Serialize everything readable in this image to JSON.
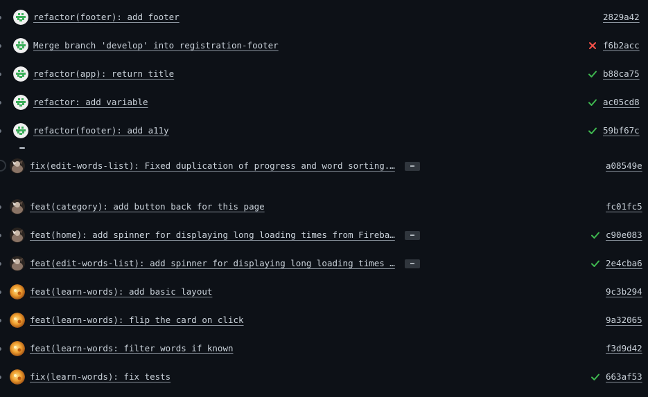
{
  "commits": [
    {
      "message": "refactor(footer): add footer",
      "sha": "2829a42",
      "status": "none",
      "avatar": "identicon"
    },
    {
      "message": "Merge branch 'develop' into registration-footer",
      "sha": "f6b2acc",
      "status": "fail",
      "avatar": "identicon"
    },
    {
      "message": "refactor(app): return title",
      "sha": "b88ca75",
      "status": "success",
      "avatar": "identicon"
    },
    {
      "message": "refactor: add variable",
      "sha": "ac05cd8",
      "status": "success",
      "avatar": "identicon"
    },
    {
      "message": "refactor(footer): add a11y",
      "sha": "59bf67c",
      "status": "success",
      "avatar": "identicon"
    },
    {
      "message": "fix(edit-words-list): Fixed duplication of progress and word sorting.…",
      "sha": "a08549e",
      "status": "none",
      "avatar": "photo",
      "more_label": "…"
    },
    {
      "message": "feat(category): add button back for this page",
      "sha": "fc01fc5",
      "status": "none",
      "avatar": "photo"
    },
    {
      "message": "feat(home): add spinner for displaying long loading times from Fireba…",
      "sha": "c90e083",
      "status": "success",
      "avatar": "photo",
      "more_label": "…"
    },
    {
      "message": "feat(edit-words-list): add spinner for displaying long loading times …",
      "sha": "2e4cba6",
      "status": "success",
      "avatar": "photo",
      "more_label": "…"
    },
    {
      "message": "feat(learn-words): add basic layout",
      "sha": "9c3b294",
      "status": "none",
      "avatar": "orange"
    },
    {
      "message": "feat(learn-words): flip the card on click",
      "sha": "9a32065",
      "status": "none",
      "avatar": "orange"
    },
    {
      "message": "feat(learn-words: filter words if known",
      "sha": "f3d9d42",
      "status": "none",
      "avatar": "orange"
    },
    {
      "message": "fix(learn-words): fix tests",
      "sha": "663af53",
      "status": "success",
      "avatar": "orange"
    }
  ],
  "icons": {
    "success": "check-icon",
    "fail": "x-icon",
    "more": "ellipsis-icon"
  },
  "colors": {
    "background": "#0d1117",
    "text": "#c9d1d9",
    "success": "#3fb950",
    "fail": "#f85149",
    "button": "#30363d"
  }
}
